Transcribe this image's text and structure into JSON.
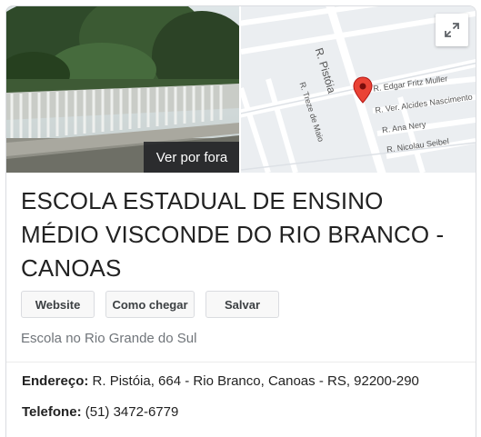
{
  "media": {
    "street_view_label": "Ver por fora",
    "expand_icon": "expand-arrows-icon",
    "map": {
      "streets": [
        "R. Pistóia",
        "R. Edgar Fritz Muller",
        "R. Ver. Alcides Nascimento",
        "R. Ana Nery",
        "R. Nicolau Seibel",
        "R. Treze de Maio"
      ],
      "marker_icon": "map-pin-icon",
      "marker_color": "#ea4335"
    }
  },
  "place": {
    "name": "ESCOLA ESTADUAL DE ENSINO MÉDIO VISCONDE DO RIO BRANCO - CANOAS",
    "category": "Escola no Rio Grande do Sul"
  },
  "actions": {
    "website": "Website",
    "directions": "Como chegar",
    "save": "Salvar"
  },
  "info": {
    "address_label": "Endereço:",
    "address_value": "R. Pistóia, 664 - Rio Branco, Canoas - RS, 92200-290",
    "phone_label": "Telefone:",
    "phone_value": "(51) 3472-6779"
  }
}
